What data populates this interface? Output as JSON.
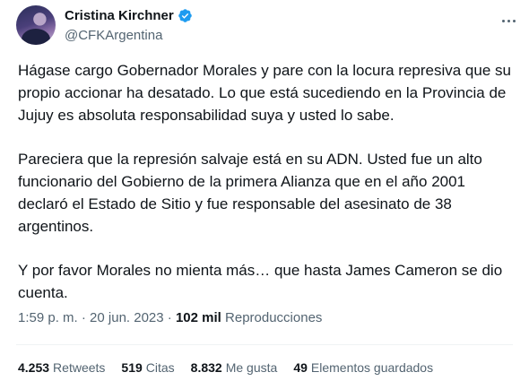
{
  "author": {
    "name": "Cristina Kirchner",
    "handle": "@CFKArgentina"
  },
  "tweet": {
    "paragraphs": [
      "Hágase cargo Gobernador Morales y pare con la locura represiva que su propio accionar ha desatado. Lo que está sucediendo en la Provincia de Jujuy es absoluta responsabilidad suya y usted lo sabe.",
      "Pareciera que la represión salvaje está en su ADN. Usted fue un alto funcionario del Gobierno de la primera Alianza que en el año 2001 declaró el Estado de Sitio y fue responsable del asesinato de 38 argentinos.",
      "Y por favor Morales no mienta más… que hasta James Cameron se dio cuenta."
    ]
  },
  "meta": {
    "time": "1:59 p. m.",
    "separator": "·",
    "date": "20 jun. 2023",
    "views_count": "102 mil",
    "views_label": "Reproducciones"
  },
  "stats": {
    "retweets_count": "4.253",
    "retweets_label": "Retweets",
    "quotes_count": "519",
    "quotes_label": "Citas",
    "likes_count": "8.832",
    "likes_label": "Me gusta",
    "bookmarks_count": "49",
    "bookmarks_label": "Elementos guardados"
  },
  "colors": {
    "verified": "#1d9bf0",
    "text_primary": "#0f1419",
    "text_secondary": "#536471"
  }
}
